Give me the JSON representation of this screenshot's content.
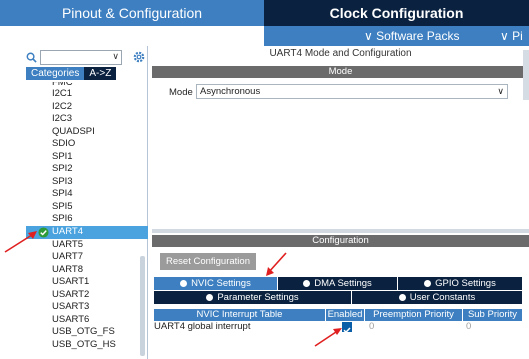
{
  "top_tabs": {
    "pinout": "Pinout & Configuration",
    "clock": "Clock Configuration"
  },
  "sub_bar": {
    "software_packs": "∨ Software Packs",
    "more": "∨ Pi"
  },
  "left": {
    "category_tabs": [
      "Categories",
      "A->Z"
    ],
    "items": [
      "FMC",
      "I2C1",
      "I2C2",
      "I2C3",
      "QUADSPI",
      "SDIO",
      "SPI1",
      "SPI2",
      "SPI3",
      "SPI4",
      "SPI5",
      "SPI6",
      "UART4",
      "UART5",
      "UART7",
      "UART8",
      "USART1",
      "USART2",
      "USART3",
      "USART6",
      "USB_OTG_FS",
      "USB_OTG_HS"
    ],
    "selected_item": "UART4"
  },
  "right": {
    "panel_title": "UART4 Mode and Configuration",
    "mode_header": "Mode",
    "mode_label": "Mode",
    "mode_value": "Asynchronous",
    "config_header": "Configuration",
    "reset_button": "Reset Configuration",
    "settings_tabs": [
      "NVIC Settings",
      "DMA Settings",
      "GPIO Settings",
      "Parameter Settings",
      "User Constants"
    ],
    "active_tab": "NVIC Settings",
    "table_headers": [
      "NVIC Interrupt Table",
      "Enabled",
      "Preemption Priority",
      "Sub Priority"
    ],
    "rows": [
      {
        "name": "UART4 global interrupt",
        "enabled": true,
        "preemption": "0",
        "sub": "0"
      }
    ]
  },
  "colors": {
    "accent": "#3d7fc0",
    "dark": "#0a2240",
    "selection": "#4aa3df",
    "arrow": "#e02020"
  }
}
